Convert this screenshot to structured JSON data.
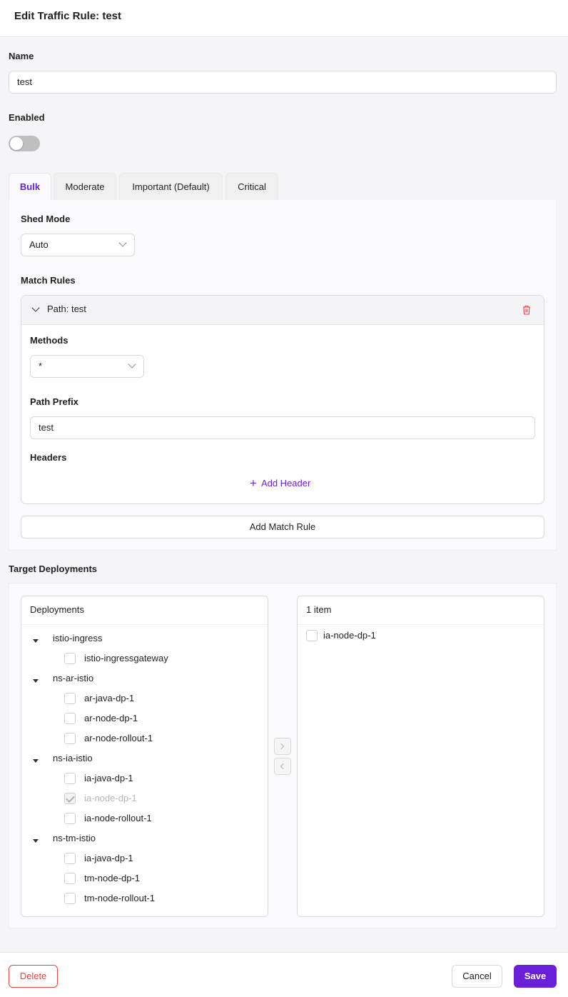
{
  "header": {
    "title": "Edit Traffic Rule: test"
  },
  "form": {
    "name_label": "Name",
    "name_value": "test",
    "enabled_label": "Enabled",
    "enabled": false
  },
  "tabs": [
    {
      "label": "Bulk",
      "active": true
    },
    {
      "label": "Moderate",
      "active": false
    },
    {
      "label": "Important (Default)",
      "active": false
    },
    {
      "label": "Critical",
      "active": false
    }
  ],
  "bulk": {
    "shed_mode_label": "Shed Mode",
    "shed_mode_value": "Auto",
    "match_rules_label": "Match Rules",
    "rule": {
      "title": "Path: test",
      "methods_label": "Methods",
      "methods_value": "*",
      "path_prefix_label": "Path Prefix",
      "path_prefix_value": "test",
      "headers_label": "Headers",
      "add_header_label": "Add Header"
    },
    "add_match_rule_label": "Add Match Rule"
  },
  "targets": {
    "label": "Target Deployments",
    "source_title": "Deployments",
    "groups": [
      {
        "name": "istio-ingress",
        "items": [
          "istio-ingressgateway"
        ]
      },
      {
        "name": "ns-ar-istio",
        "items": [
          "ar-java-dp-1",
          "ar-node-dp-1",
          "ar-node-rollout-1"
        ]
      },
      {
        "name": "ns-ia-istio",
        "items": [
          "ia-java-dp-1",
          "ia-node-dp-1",
          "ia-node-rollout-1"
        ]
      },
      {
        "name": "ns-tm-istio",
        "items": [
          "ia-java-dp-1",
          "tm-node-dp-1",
          "tm-node-rollout-1"
        ]
      }
    ],
    "target_title": "1 item",
    "target_items": [
      "ia-node-dp-1"
    ]
  },
  "footer": {
    "delete_label": "Delete",
    "cancel_label": "Cancel",
    "save_label": "Save"
  },
  "colors": {
    "accent": "#6a1fd8",
    "danger": "#e34545"
  }
}
